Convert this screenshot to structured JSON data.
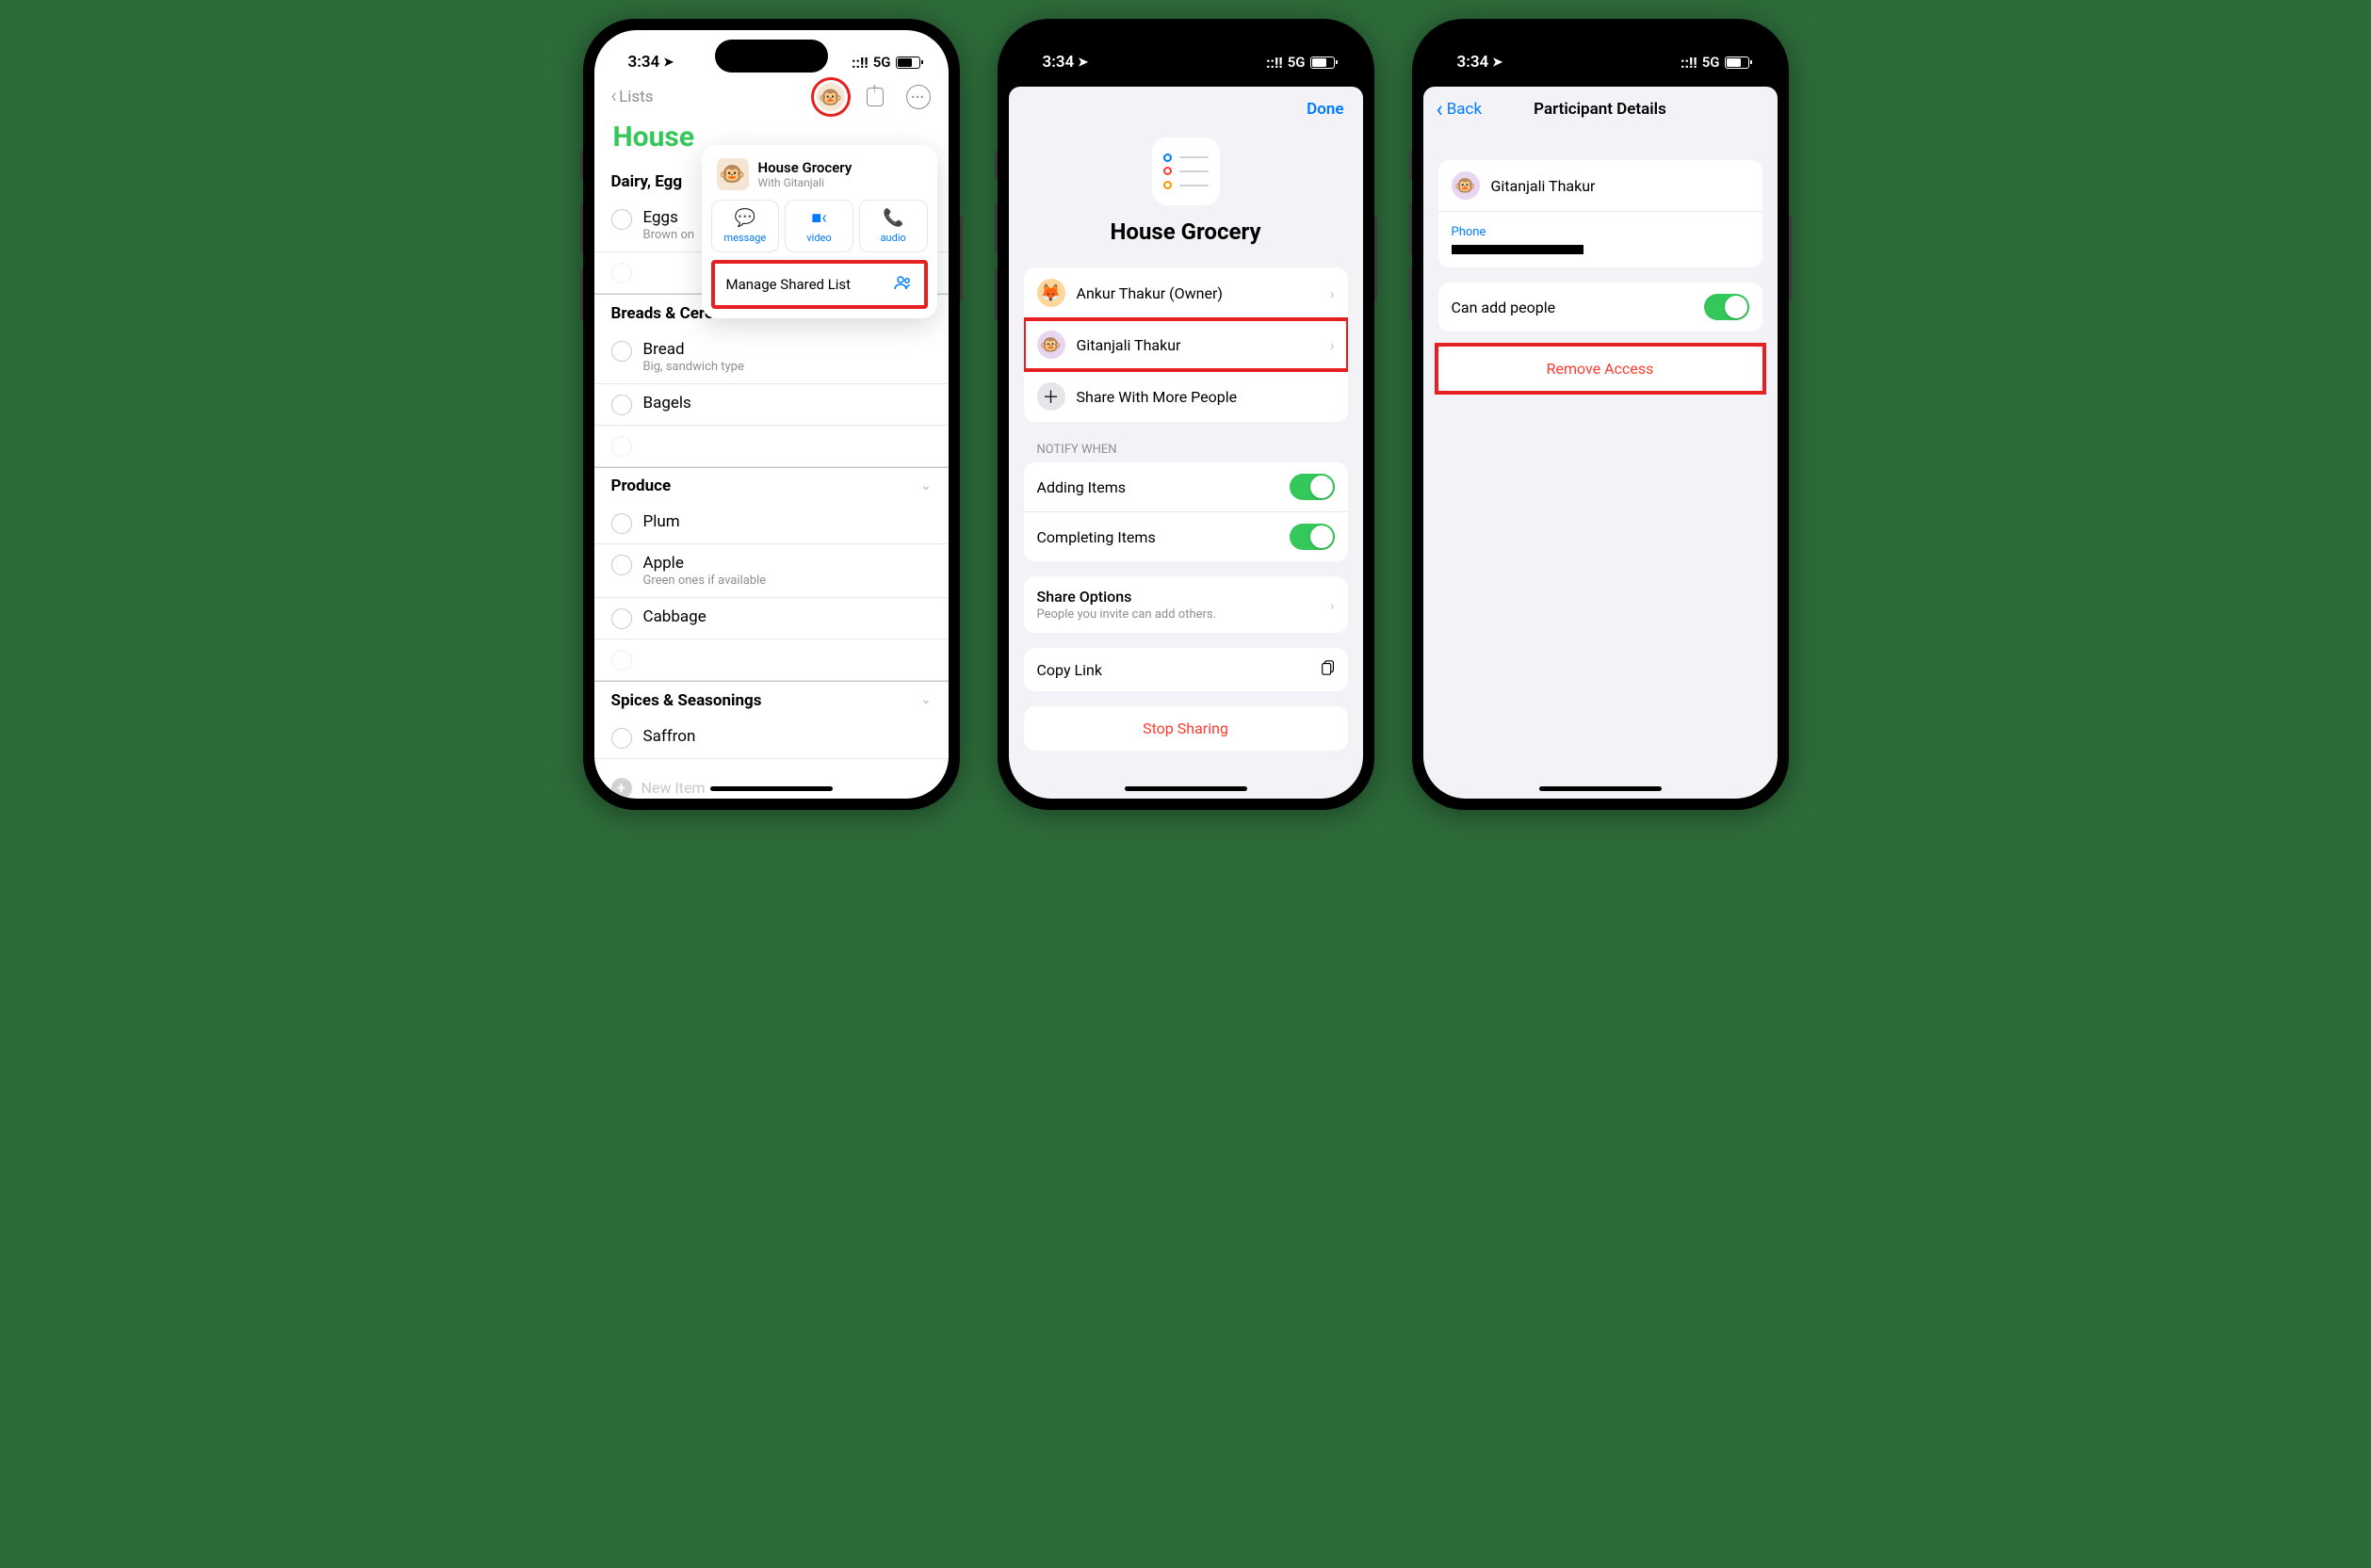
{
  "status": {
    "time": "3:34",
    "network": "5G",
    "signal": "::!!"
  },
  "phone1": {
    "back_label": "Lists",
    "list_title": "House",
    "sections": [
      {
        "name": "Dairy, Egg",
        "items": [
          {
            "name": "Eggs",
            "sub": "Brown on"
          },
          {
            "name": "",
            "dotted": true
          }
        ]
      },
      {
        "name": "Breads & Cereals",
        "items": [
          {
            "name": "Bread",
            "sub": "Big, sandwich type"
          },
          {
            "name": "Bagels"
          },
          {
            "name": "",
            "dotted": true
          }
        ]
      },
      {
        "name": "Produce",
        "items": [
          {
            "name": "Plum"
          },
          {
            "name": "Apple",
            "sub": "Green ones if available"
          },
          {
            "name": "Cabbage"
          },
          {
            "name": "",
            "dotted": true
          }
        ]
      },
      {
        "name": "Spices & Seasonings",
        "items": [
          {
            "name": "Saffron"
          }
        ]
      }
    ],
    "new_item": "New Item",
    "popover": {
      "title": "House Grocery",
      "subtitle": "With Gitanjali",
      "buttons": [
        "message",
        "video",
        "audio"
      ],
      "manage": "Manage Shared List"
    }
  },
  "phone2": {
    "done": "Done",
    "title": "House Grocery",
    "participants": [
      {
        "name": "Ankur Thakur (Owner)",
        "emoji": "🦊",
        "bg": "#ffd699"
      },
      {
        "name": "Gitanjali Thakur",
        "emoji": "🐵",
        "bg": "#e8d5f0"
      }
    ],
    "share_more": "Share With More People",
    "notify_header": "NOTIFY WHEN",
    "notify": [
      {
        "label": "Adding Items"
      },
      {
        "label": "Completing Items"
      }
    ],
    "share_options": {
      "title": "Share Options",
      "sub": "People you invite can add others."
    },
    "copy_link": "Copy Link",
    "stop_sharing": "Stop Sharing"
  },
  "phone3": {
    "back": "Back",
    "title": "Participant Details",
    "contact": {
      "name": "Gitanjali Thakur",
      "emoji": "🐵",
      "bg": "#e8d5f0"
    },
    "phone_label": "Phone",
    "toggle_label": "Can add people",
    "remove": "Remove Access"
  }
}
